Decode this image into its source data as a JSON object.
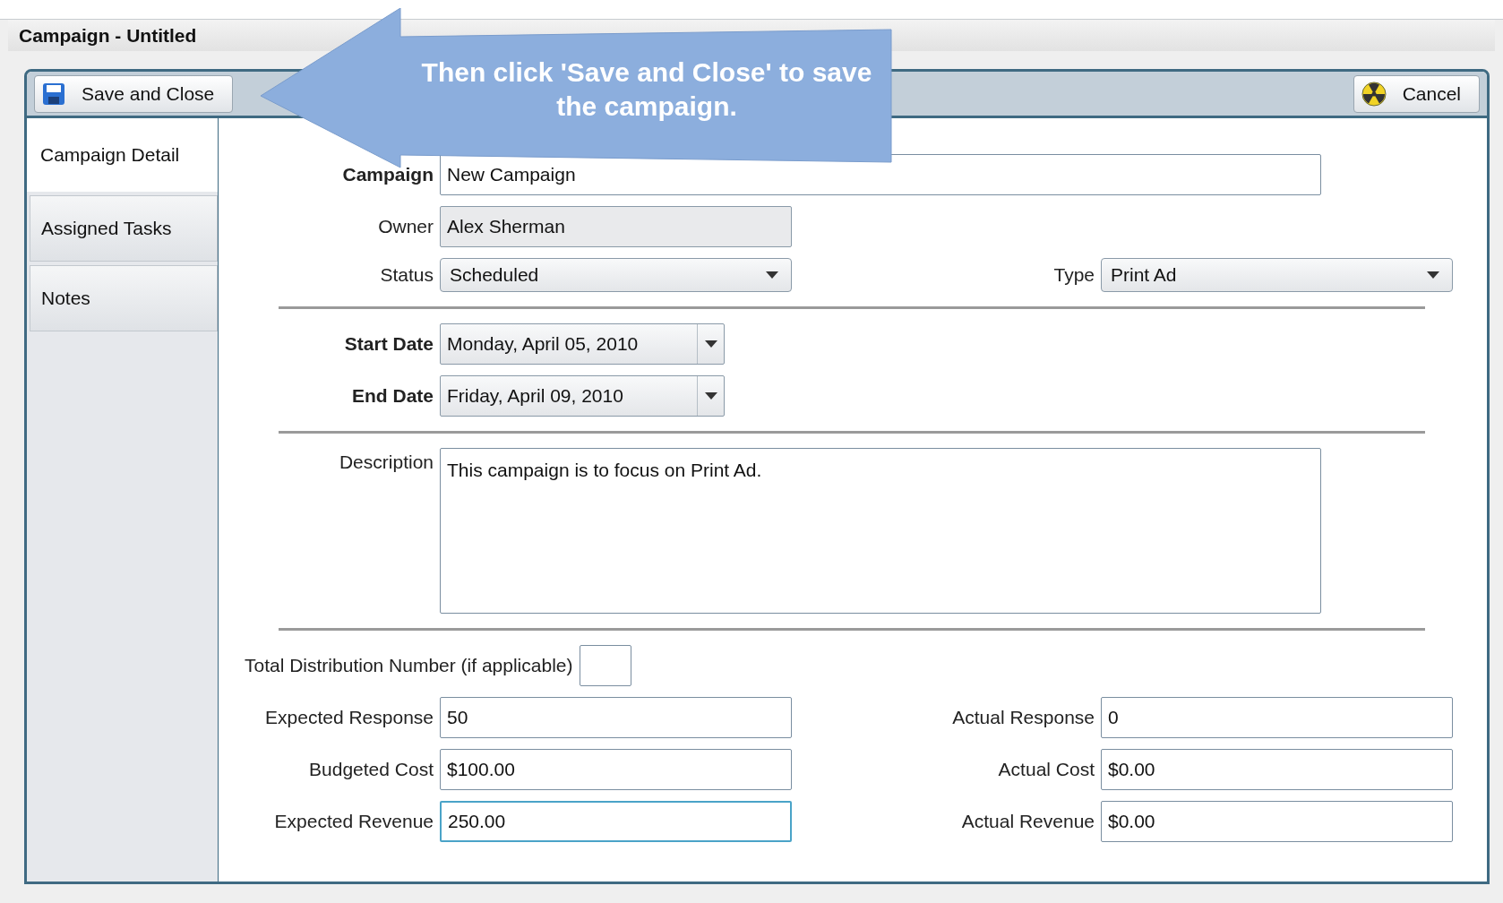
{
  "window": {
    "title": "Campaign - Untitled"
  },
  "toolbar": {
    "buttons": [
      {
        "label": "Save and Close",
        "kind": "save"
      },
      {
        "label": "Cancel",
        "kind": "cancel"
      }
    ]
  },
  "callout": {
    "text": "Then click 'Save and Close' to save the campaign."
  },
  "tabs": [
    {
      "label": "Campaign Detail",
      "selected": true
    },
    {
      "label": "Assigned Tasks",
      "selected": false
    },
    {
      "label": "Notes",
      "selected": false
    }
  ],
  "form": {
    "sections": [
      {
        "rows": [
          {
            "fields": [
              {
                "label": "Campaign",
                "bold": true,
                "kind": "wide",
                "value": "New Campaign"
              }
            ]
          },
          {
            "fields": [
              {
                "label": "Owner",
                "bold": false,
                "kind": "readonly",
                "value": "Alex Sherman"
              }
            ]
          },
          {
            "fields": [
              {
                "label": "Status",
                "bold": false,
                "kind": "dropdown",
                "value": "Scheduled"
              },
              {
                "label": "Type",
                "bold": false,
                "kind": "dropdown",
                "value": "Print Ad"
              }
            ]
          }
        ]
      },
      {
        "rows": [
          {
            "fields": [
              {
                "label": "Start Date",
                "bold": true,
                "kind": "date",
                "value": "Monday, April 05, 2010"
              }
            ]
          },
          {
            "fields": [
              {
                "label": "End Date",
                "bold": true,
                "kind": "date",
                "value": "Friday, April 09, 2010"
              }
            ]
          }
        ]
      },
      {
        "rows": [
          {
            "fields": [
              {
                "label": "Description",
                "bold": false,
                "kind": "textarea",
                "value": "This campaign is to focus on Print Ad."
              }
            ]
          }
        ]
      },
      {
        "rows": [
          {
            "fields": [
              {
                "label": "Total Distribution Number (if applicable)",
                "bold": false,
                "kind": "small"
              }
            ]
          },
          {
            "fields": [
              {
                "label": "Expected Response",
                "bold": false,
                "kind": "text",
                "value": "50"
              },
              {
                "label": "Actual Response",
                "bold": false,
                "kind": "text",
                "value": "0"
              }
            ]
          },
          {
            "fields": [
              {
                "label": "Budgeted Cost",
                "bold": false,
                "kind": "text",
                "value": "$100.00"
              },
              {
                "label": "Actual Cost",
                "bold": false,
                "kind": "text",
                "value": "$0.00"
              }
            ]
          },
          {
            "fields": [
              {
                "label": "Expected Revenue",
                "bold": false,
                "kind": "focused",
                "value": "250.00"
              },
              {
                "label": "Actual Revenue",
                "bold": false,
                "kind": "text",
                "value": "$0.00"
              }
            ]
          }
        ]
      }
    ]
  }
}
